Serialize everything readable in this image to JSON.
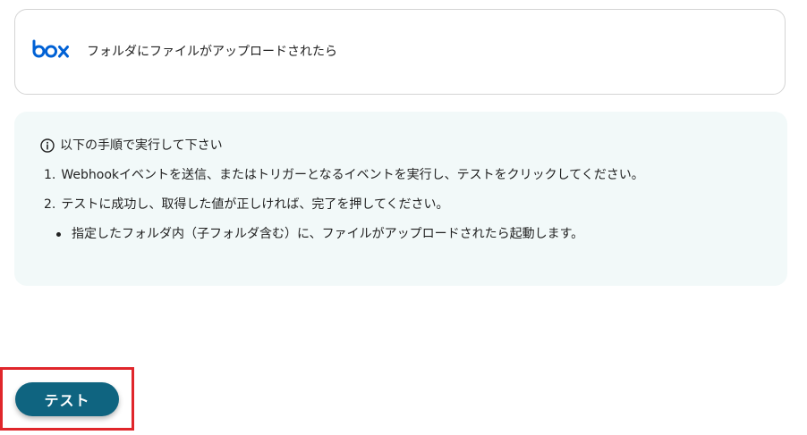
{
  "trigger": {
    "app_icon": "box-logo",
    "label": "フォルダにファイルがアップロードされたら"
  },
  "instructions": {
    "icon": "info-icon",
    "title": "以下の手順で実行して下さい",
    "steps": [
      {
        "number": "1.",
        "text": "Webhookイベントを送信、またはトリガーとなるイベントを実行し、テストをクリックしてください。"
      },
      {
        "number": "2.",
        "text": "テストに成功し、取得した値が正しければ、完了を押してください。"
      }
    ],
    "notes": [
      "指定したフォルダ内（子フォルダ含む）に、ファイルがアップロードされたら起動します。"
    ]
  },
  "actions": {
    "test_label": "テスト"
  },
  "colors": {
    "box_brand": "#0061d5",
    "button_bg": "#0f6480",
    "panel_bg": "#f2f9f9",
    "highlight": "#e0262b"
  }
}
